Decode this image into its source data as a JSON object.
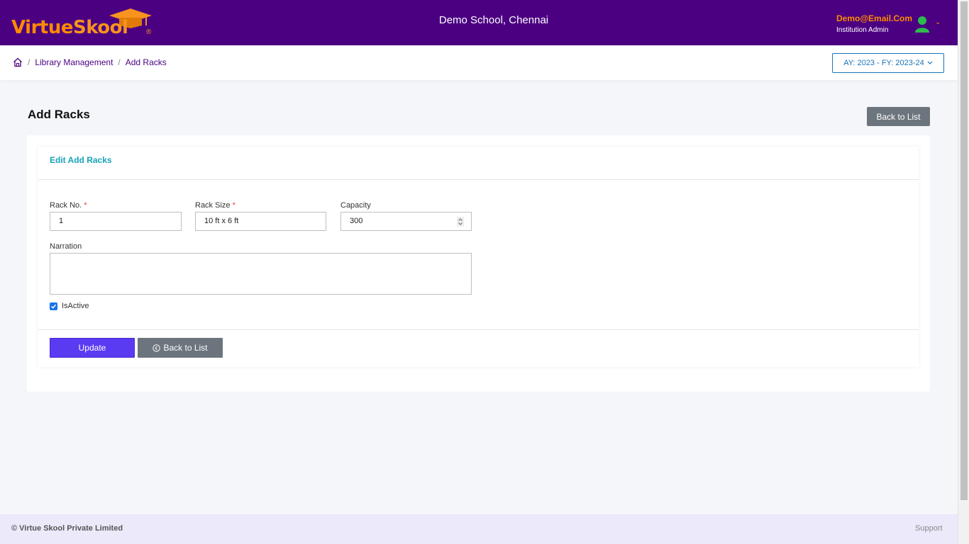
{
  "header": {
    "logo": {
      "part1": "Virtue",
      "part2": "Skool",
      "reg": "®"
    },
    "school_name": "Demo School, Chennai",
    "user_email": "Demo@Email.Com",
    "user_role": "Institution Admin",
    "caret": "⌄"
  },
  "breadcrumb": {
    "items": [
      "Library Management",
      "Add Racks"
    ],
    "separator": "/"
  },
  "ay_selector": {
    "label": "AY: 2023 - FY: 2023-24"
  },
  "page": {
    "title": "Add Racks",
    "back_label": "Back to List"
  },
  "form": {
    "title": "Edit Add Racks",
    "rack_no": {
      "label": "Rack No.",
      "value": "1",
      "required": "*"
    },
    "rack_size": {
      "label": "Rack Size",
      "value": "10 ft x 6 ft",
      "required": "*"
    },
    "capacity": {
      "label": "Capacity",
      "value": "300"
    },
    "narration": {
      "label": "Narration",
      "value": ""
    },
    "is_active": {
      "label": "IsActive",
      "checked": true
    },
    "update_label": "Update",
    "back_label": "Back to List"
  },
  "footer": {
    "copyright": "© Virtue Skool Private Limited",
    "support": "Support"
  },
  "colors": {
    "brand": "#4b0082",
    "accent_orange": "#ff8a00",
    "primary_button": "#5b3bf2",
    "secondary_button": "#6c757d",
    "card_title": "#17a2b8"
  }
}
